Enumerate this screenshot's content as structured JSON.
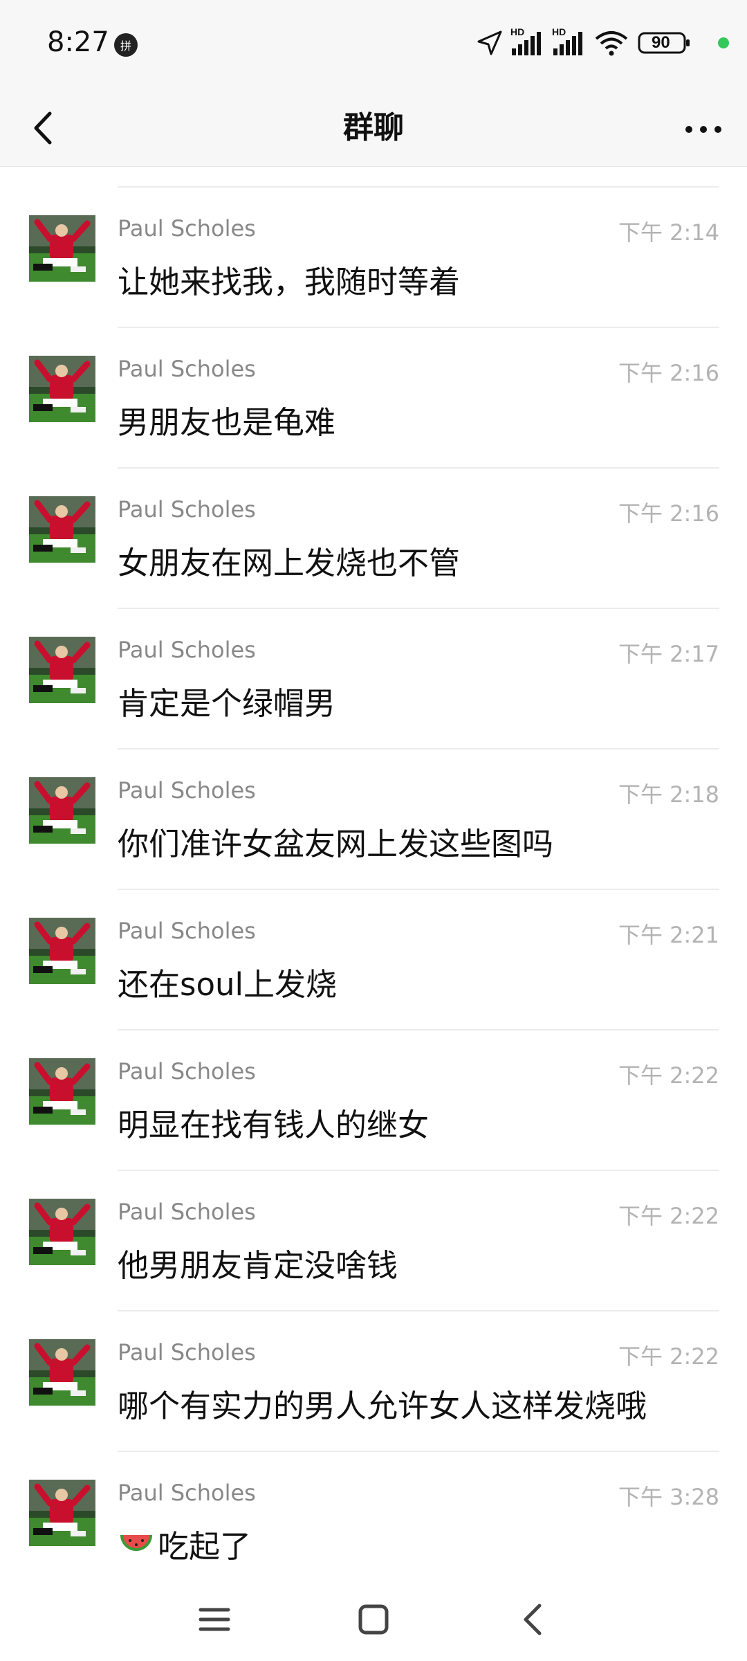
{
  "status_bar": {
    "time": "8:27",
    "badge": "拼",
    "battery": "90",
    "signal_label_1": "HD",
    "signal_label_2": "HD",
    "colors": {
      "dot": "#34c759"
    }
  },
  "header": {
    "title": "群聊",
    "back_icon": "chevron-left-icon",
    "more_icon": "more-horizontal-icon"
  },
  "messages": [
    {
      "sender": "Paul Scholes",
      "time": "下午 2:14",
      "text": "让她来找我，我随时等着"
    },
    {
      "sender": "Paul Scholes",
      "time": "下午 2:16",
      "text": "男朋友也是龟难"
    },
    {
      "sender": "Paul Scholes",
      "time": "下午 2:16",
      "text": "女朋友在网上发烧也不管"
    },
    {
      "sender": "Paul Scholes",
      "time": "下午 2:17",
      "text": "肯定是个绿帽男"
    },
    {
      "sender": "Paul Scholes",
      "time": "下午 2:18",
      "text": "你们准许女盆友网上发这些图吗"
    },
    {
      "sender": "Paul Scholes",
      "time": "下午 2:21",
      "text": "还在soul上发烧"
    },
    {
      "sender": "Paul Scholes",
      "time": "下午 2:22",
      "text": "明显在找有钱人的继女"
    },
    {
      "sender": "Paul Scholes",
      "time": "下午 2:22",
      "text": "他男朋友肯定没啥钱"
    },
    {
      "sender": "Paul Scholes",
      "time": "下午 2:22",
      "text": "哪个有实力的男人允许女人这样发烧哦"
    },
    {
      "sender": "Paul Scholes",
      "time": "下午 3:28",
      "text": "吃起了",
      "emoji": "watermelon-icon"
    }
  ],
  "nav_bar": {
    "menu_icon": "menu-icon",
    "home_icon": "home-square-icon",
    "back_icon": "back-chevron-icon"
  }
}
